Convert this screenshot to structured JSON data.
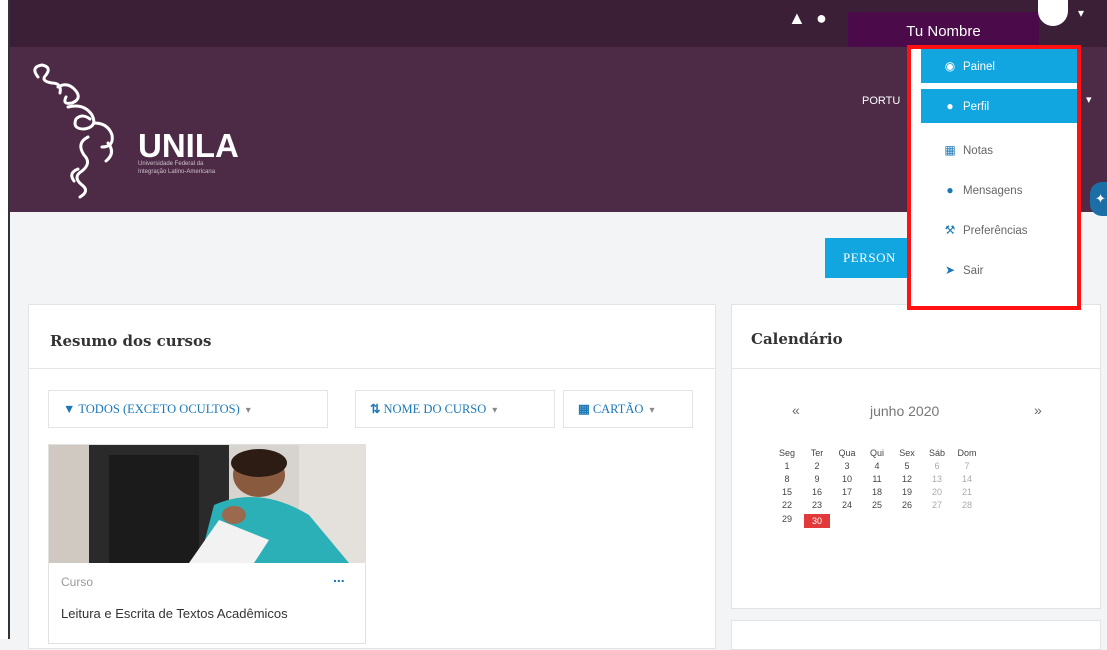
{
  "header": {
    "user_name": "Tu Nombre",
    "language": "PORTU"
  },
  "banner": {
    "logo_text": "UNILA",
    "logo_subtitle": "Universidade Federal da Integração Latino-Americana"
  },
  "customize_button": {
    "label": "PERSON"
  },
  "user_menu": {
    "items": [
      {
        "label": "Painel",
        "icon": "dashboard-icon"
      },
      {
        "label": "Perfil",
        "icon": "user-icon"
      },
      {
        "label": "Notas",
        "icon": "grades-table-icon"
      },
      {
        "label": "Mensagens",
        "icon": "chat-bubble-icon"
      },
      {
        "label": "Preferências",
        "icon": "wrench-icon"
      },
      {
        "label": "Sair",
        "icon": "logout-icon"
      }
    ]
  },
  "course_overview": {
    "title": "Resumo dos cursos",
    "filters": [
      {
        "label": "TODOS (EXCETO OCULTOS)",
        "icon": "funnel-icon"
      },
      {
        "label": "NOME DO CURSO",
        "icon": "sort-icon"
      },
      {
        "label": "CARTÃO",
        "icon": "grid-icon"
      }
    ],
    "course": {
      "category": "Curso",
      "name": "Leitura e Escrita de Textos Acadêmicos",
      "more": "..."
    }
  },
  "calendar": {
    "title": "Calendário",
    "month": "junho 2020",
    "prev": "«",
    "next": "»",
    "weekdays": [
      "Seg",
      "Ter",
      "Qua",
      "Qui",
      "Sex",
      "Sáb",
      "Dom"
    ],
    "weeks": [
      [
        "1",
        "2",
        "3",
        "4",
        "5",
        "6",
        "7"
      ],
      [
        "8",
        "9",
        "10",
        "11",
        "12",
        "13",
        "14"
      ],
      [
        "15",
        "16",
        "17",
        "18",
        "19",
        "20",
        "21"
      ],
      [
        "22",
        "23",
        "24",
        "25",
        "26",
        "27",
        "28"
      ],
      [
        "29",
        "30",
        "",
        "",
        "",
        "",
        ""
      ]
    ],
    "today": "30"
  }
}
